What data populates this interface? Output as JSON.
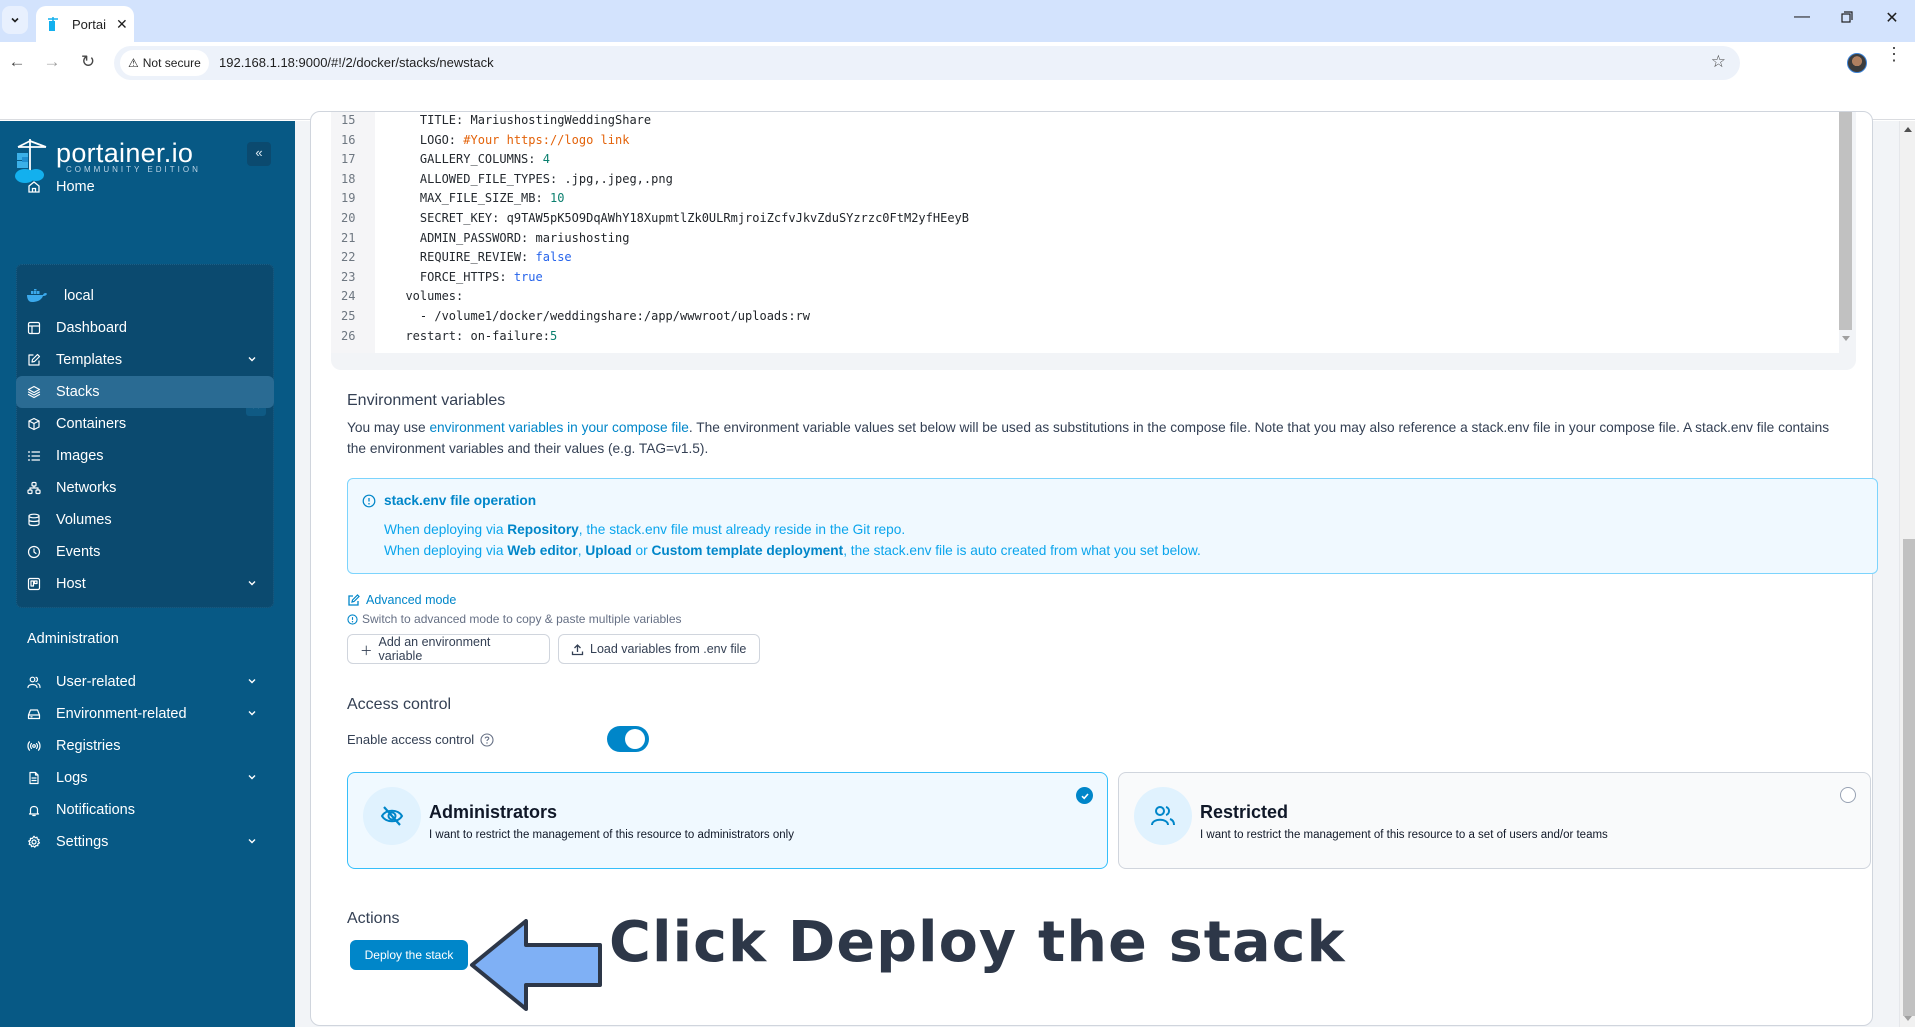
{
  "browser": {
    "tab_title": "Portainer",
    "tab_title_visible": "Portai",
    "security_label": "Not secure",
    "url": "192.168.1.18:9000/#!/2/docker/stacks/newstack"
  },
  "sidebar": {
    "logo_name": "portainer.io",
    "logo_edition": "COMMUNITY EDITION",
    "home": "Home",
    "environment": {
      "name": "local",
      "items": [
        {
          "label": "Dashboard",
          "icon": "dashboard-icon",
          "expandable": false
        },
        {
          "label": "Templates",
          "icon": "edit-icon",
          "expandable": true
        },
        {
          "label": "Stacks",
          "icon": "layers-icon",
          "expandable": false,
          "active": true
        },
        {
          "label": "Containers",
          "icon": "box-icon",
          "expandable": false
        },
        {
          "label": "Images",
          "icon": "list-icon",
          "expandable": false
        },
        {
          "label": "Networks",
          "icon": "network-icon",
          "expandable": false
        },
        {
          "label": "Volumes",
          "icon": "database-icon",
          "expandable": false
        },
        {
          "label": "Events",
          "icon": "clock-icon",
          "expandable": false
        },
        {
          "label": "Host",
          "icon": "host-icon",
          "expandable": true
        }
      ]
    },
    "admin_title": "Administration",
    "admin_items": [
      {
        "label": "User-related",
        "icon": "users-icon",
        "expandable": true
      },
      {
        "label": "Environment-related",
        "icon": "drive-icon",
        "expandable": true
      },
      {
        "label": "Registries",
        "icon": "radio-icon",
        "expandable": false
      },
      {
        "label": "Logs",
        "icon": "file-icon",
        "expandable": true
      },
      {
        "label": "Notifications",
        "icon": "bell-icon",
        "expandable": false
      },
      {
        "label": "Settings",
        "icon": "gear-icon",
        "expandable": true
      }
    ]
  },
  "editor": {
    "lines": [
      {
        "n": "15",
        "indent": "  ",
        "key": "TITLE",
        "value": "MariushostingWeddingShare",
        "type": "str"
      },
      {
        "n": "16",
        "indent": "  ",
        "key": "LOGO",
        "value": "#Your https://logo link",
        "type": "comment"
      },
      {
        "n": "17",
        "indent": "  ",
        "key": "GALLERY_COLUMNS",
        "value": "4",
        "type": "num"
      },
      {
        "n": "18",
        "indent": "  ",
        "key": "ALLOWED_FILE_TYPES",
        "value": ".jpg,.jpeg,.png",
        "type": "str"
      },
      {
        "n": "19",
        "indent": "  ",
        "key": "MAX_FILE_SIZE_MB",
        "value": "10",
        "type": "num"
      },
      {
        "n": "20",
        "indent": "  ",
        "key": "SECRET_KEY",
        "value": "q9TAW5pK5O9DqAWhY18XupmtlZk0ULRmjroiZcfvJkvZduSYzrzc0FtM2yfHEeyB",
        "type": "str"
      },
      {
        "n": "21",
        "indent": "  ",
        "key": "ADMIN_PASSWORD",
        "value": "mariushosting",
        "type": "str"
      },
      {
        "n": "22",
        "indent": "  ",
        "key": "REQUIRE_REVIEW",
        "value": "false",
        "type": "bool"
      },
      {
        "n": "23",
        "indent": "  ",
        "key": "FORCE_HTTPS",
        "value": "true",
        "type": "bool"
      },
      {
        "n": "24",
        "indent": "",
        "key": "volumes",
        "value": "",
        "type": "str"
      },
      {
        "n": "25",
        "indent": "  ",
        "key": "",
        "value": "- /volume1/docker/weddingshare:/app/wwwroot/uploads:rw",
        "type": "plain"
      },
      {
        "n": "26",
        "indent": "",
        "key": "restart",
        "value": "on-failure:5",
        "type": "mixed"
      }
    ]
  },
  "env_vars": {
    "title": "Environment variables",
    "para_pre": "You may use ",
    "para_link": "environment variables in your compose file",
    "para_post": ". The environment variable values set below will be used as substitutions in the compose file. Note that you may also reference a stack.env file in your compose file. A stack.env file contains the environment variables and their values (e.g. TAG=v1.5).",
    "info_title": "stack.env file operation",
    "info_l1_a": "When deploying via ",
    "info_l1_b": "Repository",
    "info_l1_c": ", the stack.env file must already reside in the Git repo.",
    "info_l2_a": "When deploying via ",
    "info_l2_b": "Web editor",
    "info_l2_c": ", ",
    "info_l2_d": "Upload",
    "info_l2_e": " or ",
    "info_l2_f": "Custom template deployment",
    "info_l2_g": ", the stack.env file is auto created from what you set below.",
    "advanced_mode": "Advanced mode",
    "advanced_hint": "Switch to advanced mode to copy & paste multiple variables",
    "add_button": "Add an environment variable",
    "load_button": "Load variables from .env file"
  },
  "access_control": {
    "title": "Access control",
    "enable_label": "Enable access control",
    "enabled": true,
    "options": [
      {
        "title": "Administrators",
        "desc": "I want to restrict the management of this resource to administrators only",
        "selected": true
      },
      {
        "title": "Restricted",
        "desc": "I want to restrict the management of this resource to a set of users and/or teams",
        "selected": false
      }
    ]
  },
  "actions": {
    "title": "Actions",
    "deploy_button": "Deploy the stack"
  },
  "annotation": {
    "text": "Click Deploy the stack",
    "arrow_color": "#7fb0f5"
  },
  "colors": {
    "sidebar": "#075985",
    "accent": "#0086c9"
  }
}
